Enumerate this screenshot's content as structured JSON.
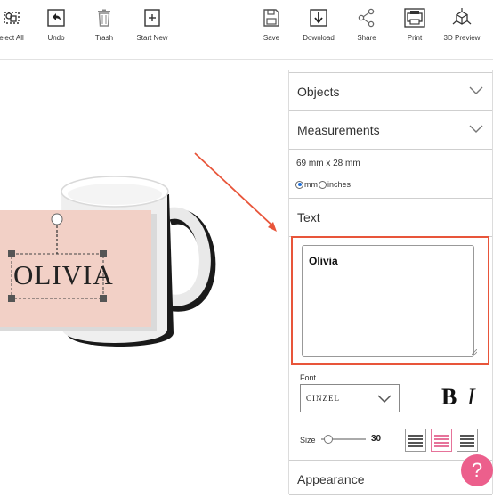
{
  "toolbar": {
    "select_all": "elect All",
    "undo": "Undo",
    "trash": "Trash",
    "start_new": "Start New",
    "save": "Save",
    "download": "Download",
    "share": "Share",
    "print": "Print",
    "preview_3d": "3D Preview"
  },
  "canvas": {
    "design_text": "OLIVIA"
  },
  "panel": {
    "objects": "Objects",
    "measurements": "Measurements",
    "dimensions": "69 mm x 28 mm",
    "unit_mm": "mm",
    "unit_inches": "inches",
    "selected_unit": "mm",
    "text_section": "Text",
    "text_value": "Olivia",
    "font_label": "Font",
    "font_value": "Cinzel",
    "bold_label": "B",
    "italic_label": "I",
    "size_label": "Size",
    "size_value": "30",
    "selected_align": "center",
    "appearance": "Appearance"
  },
  "help": {
    "label": "?"
  },
  "colors": {
    "accent_pink": "#ec5f8c",
    "highlight_orange": "#e8553a",
    "label_fill": "#f2d0c6",
    "radio_blue": "#1e6fd9"
  },
  "icons": [
    "select-all-icon",
    "undo-icon",
    "trash-icon",
    "plus-icon",
    "save-icon",
    "download-icon",
    "share-icon",
    "print-icon",
    "cube-icon",
    "chevron-down-icon",
    "rotate-handle-icon",
    "resize-grip-icon"
  ]
}
